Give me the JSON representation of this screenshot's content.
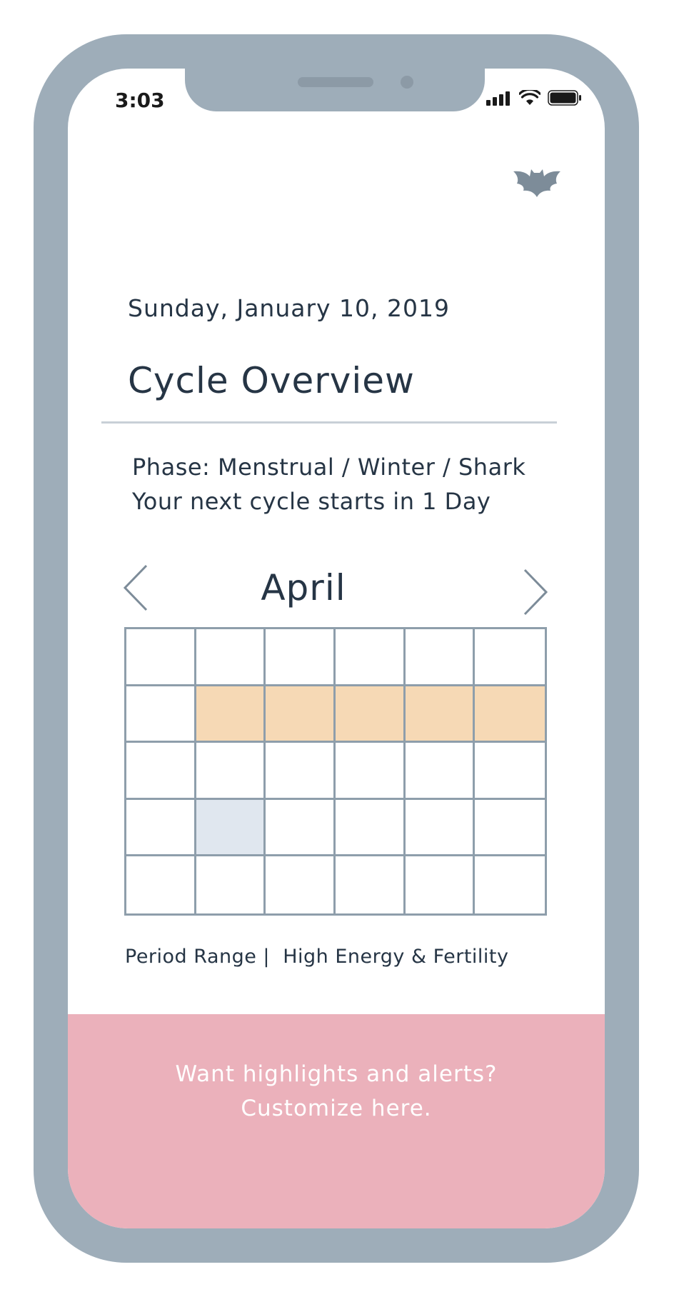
{
  "status_bar": {
    "time": "3:03",
    "icons": [
      "cellular-signal-icon",
      "wifi-icon",
      "battery-icon"
    ]
  },
  "header": {
    "logo_icon": "bat-icon",
    "date": "Sunday, January 10, 2019",
    "title": "Cycle Overview"
  },
  "phase": {
    "line1": "Phase: Menstrual / Winter / Shark",
    "line2": "Your next cycle starts in 1 Day"
  },
  "calendar": {
    "month": "April",
    "prev_icon": "chevron-left-icon",
    "next_icon": "chevron-right-icon",
    "columns": 6,
    "rows": 5,
    "period_cells": [
      7,
      8,
      9,
      10,
      11
    ],
    "highlight_cells": [
      19
    ]
  },
  "legend": {
    "text": "Period Range |  High Energy & Fertility"
  },
  "cta": {
    "line1": "Want highlights and alerts?",
    "line2": "Customize here."
  },
  "colors": {
    "device_frame": "#9eadb9",
    "text_primary": "#263545",
    "period": "#f6d9b5",
    "highlight": "#e0e7ef",
    "cta_background": "#ebb1bb",
    "logo": "#7d8c99"
  }
}
